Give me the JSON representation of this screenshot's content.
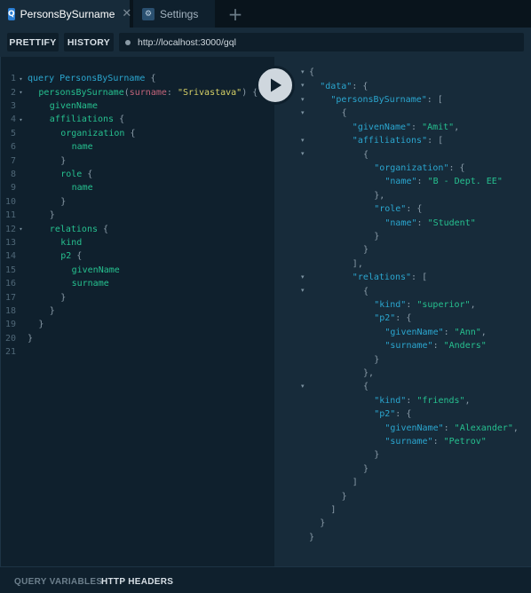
{
  "tabs": [
    {
      "badge": "Q",
      "label": "PersonsBySurname",
      "close": "✕",
      "active": true
    },
    {
      "badge": "⚙",
      "label": "Settings",
      "active": false
    }
  ],
  "new_tab": "+",
  "toolbar": {
    "prettify_label": "PRETTIFY",
    "history_label": "HISTORY",
    "url": "http://localhost:3000/gql"
  },
  "editor": {
    "lines": [
      {
        "n": "1",
        "fold": "▾",
        "indent": 0,
        "tokens": [
          [
            "kw",
            "query "
          ],
          [
            "nm",
            "PersonsBySurname"
          ],
          [
            "pun",
            " {"
          ]
        ]
      },
      {
        "n": "2",
        "fold": "▾",
        "indent": 1,
        "tokens": [
          [
            "fld",
            "personsBySurname"
          ],
          [
            "pun",
            "("
          ],
          [
            "arg",
            "surname"
          ],
          [
            "pun",
            ": "
          ],
          [
            "str",
            "\"Srivastava\""
          ],
          [
            "pun",
            ") {"
          ]
        ]
      },
      {
        "n": "3",
        "fold": "",
        "indent": 2,
        "tokens": [
          [
            "fld",
            "givenName"
          ]
        ]
      },
      {
        "n": "4",
        "fold": "▾",
        "indent": 2,
        "tokens": [
          [
            "fld",
            "affiliations"
          ],
          [
            "pun",
            " {"
          ]
        ]
      },
      {
        "n": "5",
        "fold": "",
        "indent": 3,
        "tokens": [
          [
            "fld",
            "organization"
          ],
          [
            "pun",
            " {"
          ]
        ]
      },
      {
        "n": "6",
        "fold": "",
        "indent": 4,
        "tokens": [
          [
            "fld",
            "name"
          ]
        ]
      },
      {
        "n": "7",
        "fold": "",
        "indent": 3,
        "tokens": [
          [
            "pun",
            "}"
          ]
        ]
      },
      {
        "n": "8",
        "fold": "",
        "indent": 3,
        "tokens": [
          [
            "fld",
            "role"
          ],
          [
            "pun",
            " {"
          ]
        ]
      },
      {
        "n": "9",
        "fold": "",
        "indent": 4,
        "tokens": [
          [
            "fld",
            "name"
          ]
        ]
      },
      {
        "n": "10",
        "fold": "",
        "indent": 3,
        "tokens": [
          [
            "pun",
            "}"
          ]
        ]
      },
      {
        "n": "11",
        "fold": "",
        "indent": 2,
        "tokens": [
          [
            "pun",
            "}"
          ]
        ]
      },
      {
        "n": "12",
        "fold": "▾",
        "indent": 2,
        "tokens": [
          [
            "fld",
            "relations"
          ],
          [
            "pun",
            " {"
          ]
        ]
      },
      {
        "n": "13",
        "fold": "",
        "indent": 3,
        "tokens": [
          [
            "fld",
            "kind"
          ]
        ]
      },
      {
        "n": "14",
        "fold": "",
        "indent": 3,
        "tokens": [
          [
            "fld",
            "p2"
          ],
          [
            "pun",
            " {"
          ]
        ]
      },
      {
        "n": "15",
        "fold": "",
        "indent": 4,
        "tokens": [
          [
            "fld",
            "givenName"
          ]
        ]
      },
      {
        "n": "16",
        "fold": "",
        "indent": 4,
        "tokens": [
          [
            "fld",
            "surname"
          ]
        ]
      },
      {
        "n": "17",
        "fold": "",
        "indent": 3,
        "tokens": [
          [
            "pun",
            "}"
          ]
        ]
      },
      {
        "n": "18",
        "fold": "",
        "indent": 2,
        "tokens": [
          [
            "pun",
            "}"
          ]
        ]
      },
      {
        "n": "19",
        "fold": "",
        "indent": 1,
        "tokens": [
          [
            "pun",
            "}"
          ]
        ]
      },
      {
        "n": "20",
        "fold": "",
        "indent": 0,
        "tokens": [
          [
            "pun",
            "}"
          ]
        ]
      },
      {
        "n": "21",
        "fold": "",
        "indent": 0,
        "tokens": []
      }
    ]
  },
  "result": {
    "lines": [
      {
        "fold": "▾",
        "indent": 0,
        "tokens": [
          [
            "rpun",
            "{"
          ]
        ]
      },
      {
        "fold": "▾",
        "indent": 1,
        "tokens": [
          [
            "rkey",
            "\"data\""
          ],
          [
            "rpun",
            ": {"
          ]
        ]
      },
      {
        "fold": "▾",
        "indent": 2,
        "tokens": [
          [
            "rkey",
            "\"personsBySurname\""
          ],
          [
            "rpun",
            ": ["
          ]
        ]
      },
      {
        "fold": "▾",
        "indent": 3,
        "tokens": [
          [
            "rpun",
            "{"
          ]
        ]
      },
      {
        "fold": "",
        "indent": 4,
        "tokens": [
          [
            "rkey",
            "\"givenName\""
          ],
          [
            "rpun",
            ": "
          ],
          [
            "rstr",
            "\"Amit\""
          ],
          [
            "rpun",
            ","
          ]
        ]
      },
      {
        "fold": "▾",
        "indent": 4,
        "tokens": [
          [
            "rkey",
            "\"affiliations\""
          ],
          [
            "rpun",
            ": ["
          ]
        ]
      },
      {
        "fold": "▾",
        "indent": 5,
        "tokens": [
          [
            "rpun",
            "{"
          ]
        ]
      },
      {
        "fold": "",
        "indent": 6,
        "tokens": [
          [
            "rkey",
            "\"organization\""
          ],
          [
            "rpun",
            ": {"
          ]
        ]
      },
      {
        "fold": "",
        "indent": 7,
        "tokens": [
          [
            "rkey",
            "\"name\""
          ],
          [
            "rpun",
            ": "
          ],
          [
            "rstr",
            "\"B - Dept. EE\""
          ]
        ]
      },
      {
        "fold": "",
        "indent": 6,
        "tokens": [
          [
            "rpun",
            "},"
          ]
        ]
      },
      {
        "fold": "",
        "indent": 6,
        "tokens": [
          [
            "rkey",
            "\"role\""
          ],
          [
            "rpun",
            ": {"
          ]
        ]
      },
      {
        "fold": "",
        "indent": 7,
        "tokens": [
          [
            "rkey",
            "\"name\""
          ],
          [
            "rpun",
            ": "
          ],
          [
            "rstr",
            "\"Student\""
          ]
        ]
      },
      {
        "fold": "",
        "indent": 6,
        "tokens": [
          [
            "rpun",
            "}"
          ]
        ]
      },
      {
        "fold": "",
        "indent": 5,
        "tokens": [
          [
            "rpun",
            "}"
          ]
        ]
      },
      {
        "fold": "",
        "indent": 4,
        "tokens": [
          [
            "rpun",
            "],"
          ]
        ]
      },
      {
        "fold": "▾",
        "indent": 4,
        "tokens": [
          [
            "rkey",
            "\"relations\""
          ],
          [
            "rpun",
            ": ["
          ]
        ]
      },
      {
        "fold": "▾",
        "indent": 5,
        "tokens": [
          [
            "rpun",
            "{"
          ]
        ]
      },
      {
        "fold": "",
        "indent": 6,
        "tokens": [
          [
            "rkey",
            "\"kind\""
          ],
          [
            "rpun",
            ": "
          ],
          [
            "rstr",
            "\"superior\""
          ],
          [
            "rpun",
            ","
          ]
        ]
      },
      {
        "fold": "",
        "indent": 6,
        "tokens": [
          [
            "rkey",
            "\"p2\""
          ],
          [
            "rpun",
            ": {"
          ]
        ]
      },
      {
        "fold": "",
        "indent": 7,
        "tokens": [
          [
            "rkey",
            "\"givenName\""
          ],
          [
            "rpun",
            ": "
          ],
          [
            "rstr",
            "\"Ann\""
          ],
          [
            "rpun",
            ","
          ]
        ]
      },
      {
        "fold": "",
        "indent": 7,
        "tokens": [
          [
            "rkey",
            "\"surname\""
          ],
          [
            "rpun",
            ": "
          ],
          [
            "rstr",
            "\"Anders\""
          ]
        ]
      },
      {
        "fold": "",
        "indent": 6,
        "tokens": [
          [
            "rpun",
            "}"
          ]
        ]
      },
      {
        "fold": "",
        "indent": 5,
        "tokens": [
          [
            "rpun",
            "},"
          ]
        ]
      },
      {
        "fold": "▾",
        "indent": 5,
        "tokens": [
          [
            "rpun",
            "{"
          ]
        ]
      },
      {
        "fold": "",
        "indent": 6,
        "tokens": [
          [
            "rkey",
            "\"kind\""
          ],
          [
            "rpun",
            ": "
          ],
          [
            "rstr",
            "\"friends\""
          ],
          [
            "rpun",
            ","
          ]
        ]
      },
      {
        "fold": "",
        "indent": 6,
        "tokens": [
          [
            "rkey",
            "\"p2\""
          ],
          [
            "rpun",
            ": {"
          ]
        ]
      },
      {
        "fold": "",
        "indent": 7,
        "tokens": [
          [
            "rkey",
            "\"givenName\""
          ],
          [
            "rpun",
            ": "
          ],
          [
            "rstr",
            "\"Alexander\""
          ],
          [
            "rpun",
            ","
          ]
        ]
      },
      {
        "fold": "",
        "indent": 7,
        "tokens": [
          [
            "rkey",
            "\"surname\""
          ],
          [
            "rpun",
            ": "
          ],
          [
            "rstr",
            "\"Petrov\""
          ]
        ]
      },
      {
        "fold": "",
        "indent": 6,
        "tokens": [
          [
            "rpun",
            "}"
          ]
        ]
      },
      {
        "fold": "",
        "indent": 5,
        "tokens": [
          [
            "rpun",
            "}"
          ]
        ]
      },
      {
        "fold": "",
        "indent": 4,
        "tokens": [
          [
            "rpun",
            "]"
          ]
        ]
      },
      {
        "fold": "",
        "indent": 3,
        "tokens": [
          [
            "rpun",
            "}"
          ]
        ]
      },
      {
        "fold": "",
        "indent": 2,
        "tokens": [
          [
            "rpun",
            "]"
          ]
        ]
      },
      {
        "fold": "",
        "indent": 1,
        "tokens": [
          [
            "rpun",
            "}"
          ]
        ]
      },
      {
        "fold": "",
        "indent": 0,
        "tokens": [
          [
            "rpun",
            "}"
          ]
        ]
      }
    ]
  },
  "bottom": {
    "query_variables_label": "QUERY VARIABLES",
    "http_headers_label": "HTTP HEADERS"
  }
}
